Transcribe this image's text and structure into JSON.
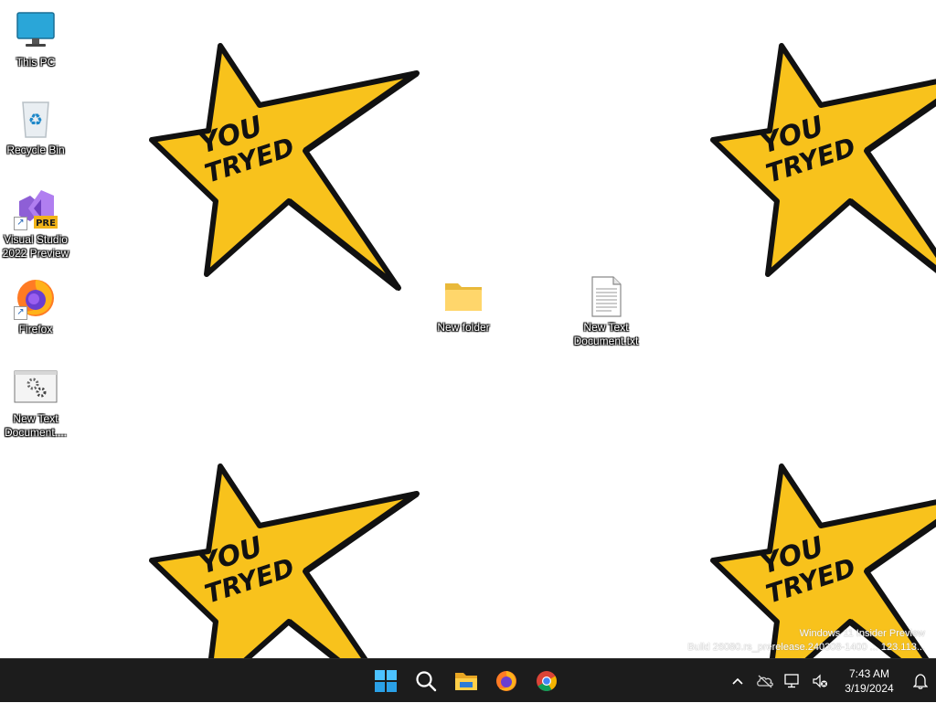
{
  "wallpaper": {
    "sticker_text_line1": "YOU",
    "sticker_text_line2": "TRYED",
    "star_color": "#f8c21c"
  },
  "desktop_icons": [
    {
      "name": "This PC"
    },
    {
      "name": "Recycle Bin"
    },
    {
      "name": "Visual Studio 2022 Preview",
      "badge": "PRE"
    },
    {
      "name": "Firefox"
    },
    {
      "name": "New Text Document...."
    },
    {
      "name": "New folder"
    },
    {
      "name": "New Text Document.txt"
    }
  ],
  "watermark": {
    "line1": "Windows 11 Insider Preview",
    "line2": "Build 26080.rs_prerelease.240308-1400 ... 123.113..."
  },
  "taskbar": {
    "pinned": [
      {
        "icon": "windows-start-icon"
      },
      {
        "icon": "search-icon"
      },
      {
        "icon": "file-explorer-icon"
      },
      {
        "icon": "firefox-icon"
      },
      {
        "icon": "chrome-icon"
      }
    ],
    "tray": {
      "time": "7:43 AM",
      "date": "3/19/2024"
    }
  }
}
